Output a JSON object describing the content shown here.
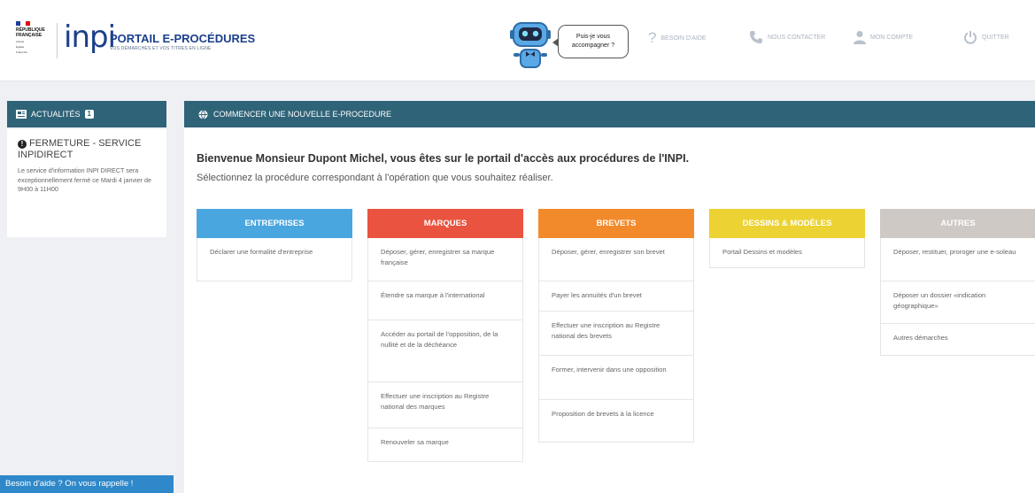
{
  "header": {
    "republique": [
      "RÉPUBLIQUE",
      "FRANÇAISE"
    ],
    "motto": [
      "Liberté",
      "Égalité",
      "Fraternité"
    ],
    "inpi": "inpi",
    "portal_title": "PORTAIL E-PROCÉDURES",
    "portal_subtitle": "VOS DÉMARCHES ET VOS TITRES EN LIGNE",
    "assistant_bubble": [
      "Puis-je vous",
      "accompagner ?"
    ],
    "nav": [
      {
        "icon": "question-icon",
        "label": "BESOIN D'AIDE"
      },
      {
        "icon": "phone-icon",
        "label": "NOUS CONTACTER"
      },
      {
        "icon": "user-icon",
        "label": "MON COMPTE"
      },
      {
        "icon": "power-icon",
        "label": "QUITTER"
      }
    ]
  },
  "sidebar": {
    "title": "ACTUALITÉS",
    "badge": "1",
    "news_title": "FERMETURE - SERVICE INPIDIRECT",
    "news_body": "Le service d'information INPI DIRECT sera exceptionnellement fermé ce Mardi 4 janvier de 9H00 à 11H00"
  },
  "main": {
    "title": "COMMENCER UNE NOUVELLE E-PROCEDURE",
    "welcome": "Bienvenue Monsieur Dupont Michel, vous êtes sur le portail d'accès aux procédures de l'INPI.",
    "instruction": "Sélectionnez la procédure correspondant à l'opération que vous souhaitez réaliser.",
    "columns": [
      {
        "title": "ENTREPRISES",
        "color": "#4aa6df",
        "items": [
          "Déclarer une formalité d'entreprise"
        ]
      },
      {
        "title": "MARQUES",
        "color": "#e9533f",
        "items": [
          "Déposer, gérer, enregistrer sa marque française",
          "Étendre sa marque à l'international",
          "Accéder au portail de l'opposition, de la nullité et de la déchéance",
          "Effectuer une inscription au Registre national des marques",
          "Renouveler sa marque"
        ]
      },
      {
        "title": "BREVETS",
        "color": "#f28a2b",
        "items": [
          "Déposer, gérer, enregistrer son brevet",
          "Payer les annuités d'un brevet",
          "Effectuer une inscription au Registre national des brevets",
          "Former, intervenir dans une opposition",
          "Proposition de brevets à la licence"
        ]
      },
      {
        "title": "DESSINS & MODÈLES",
        "color": "#ecd233",
        "items": [
          "Portail Dessins et modèles"
        ]
      },
      {
        "title": "AUTRES",
        "color": "#cfc9c5",
        "items": [
          "Déposer, restituer, proroger une e-soleau",
          "Déposer un dossier «indication géographique»",
          "Autres démarches"
        ]
      }
    ]
  },
  "help_button": "Besoin d'aide ? On vous rappelle !"
}
